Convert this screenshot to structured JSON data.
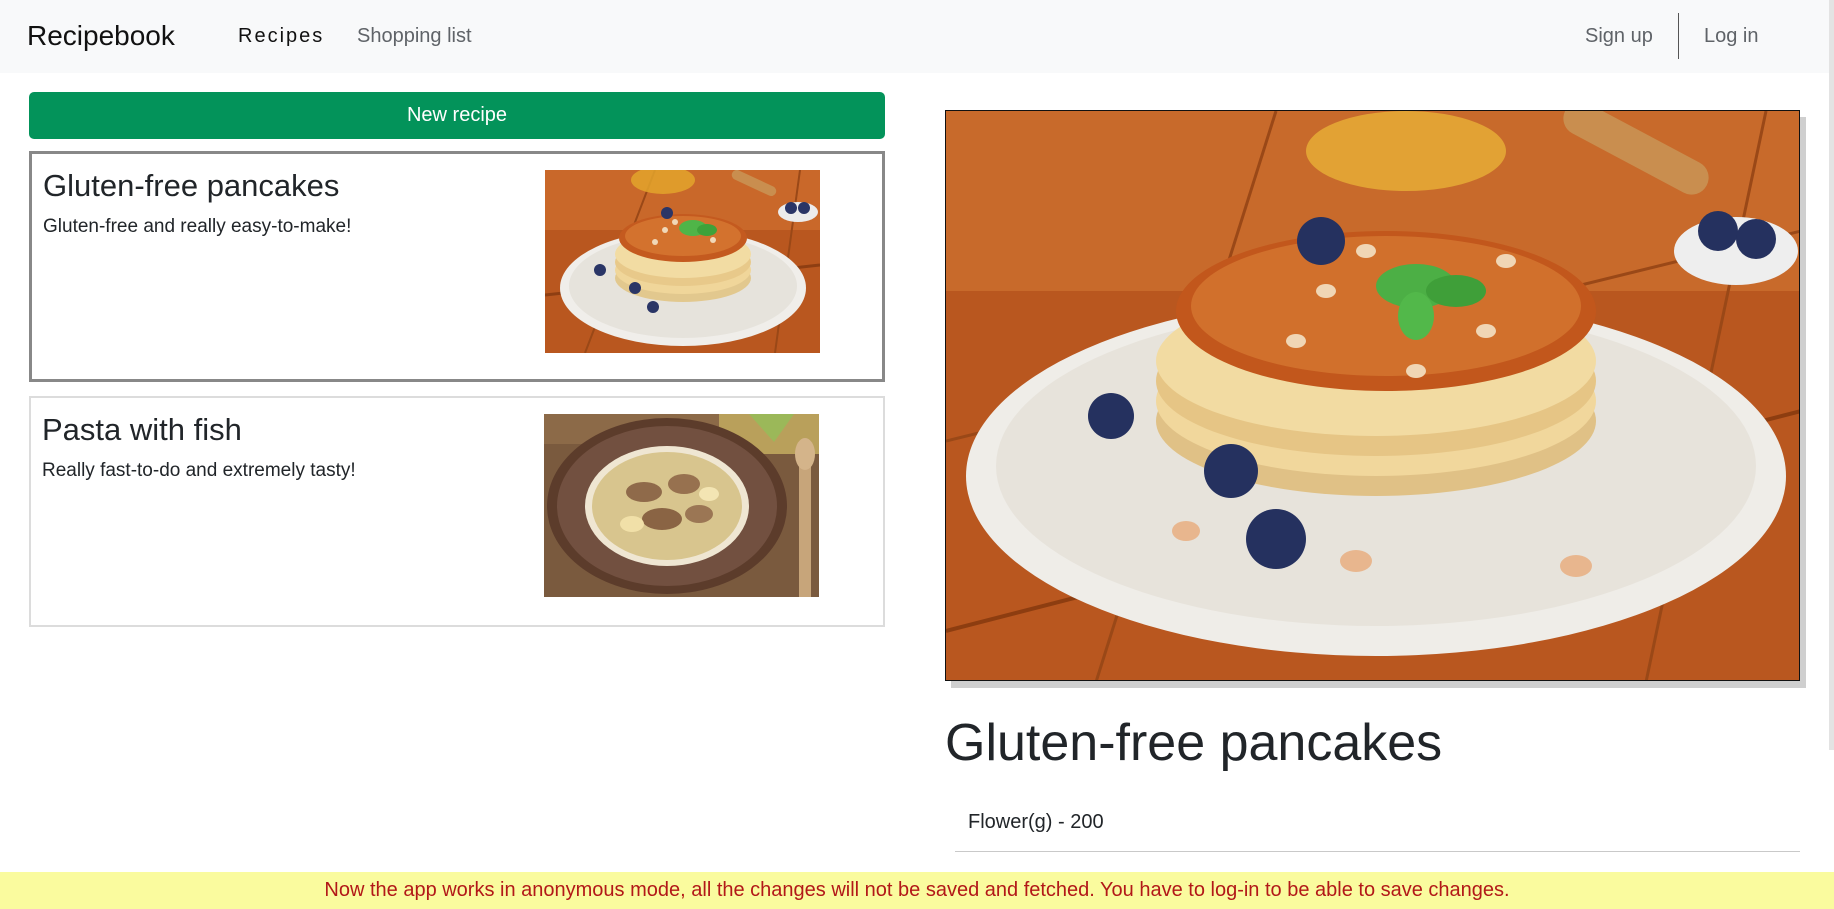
{
  "navbar": {
    "brand": "Recipebook",
    "links": [
      "Recipes",
      "Shopping list"
    ],
    "signup": "Sign up",
    "login": "Log in"
  },
  "actions": {
    "new_recipe": "New recipe"
  },
  "recipes": [
    {
      "title": "Gluten-free pancakes",
      "description": "Gluten-free and really easy-to-make!",
      "image": "pancakes-photo",
      "selected": true
    },
    {
      "title": "Pasta with fish",
      "description": "Really fast-to-do and extremely tasty!",
      "image": "pasta-photo",
      "selected": false
    }
  ],
  "detail": {
    "title": "Gluten-free pancakes",
    "ingredients": [
      "Flower(g) - 200"
    ]
  },
  "banner": "Now the app works in anonymous mode, all the changes will not be saved and fetched. You have to log-in to be able to save changes.",
  "colors": {
    "accent": "#03935a",
    "banner_bg": "#fafb9e",
    "banner_text": "#b21818",
    "navbar_bg": "#f8f9fa"
  }
}
